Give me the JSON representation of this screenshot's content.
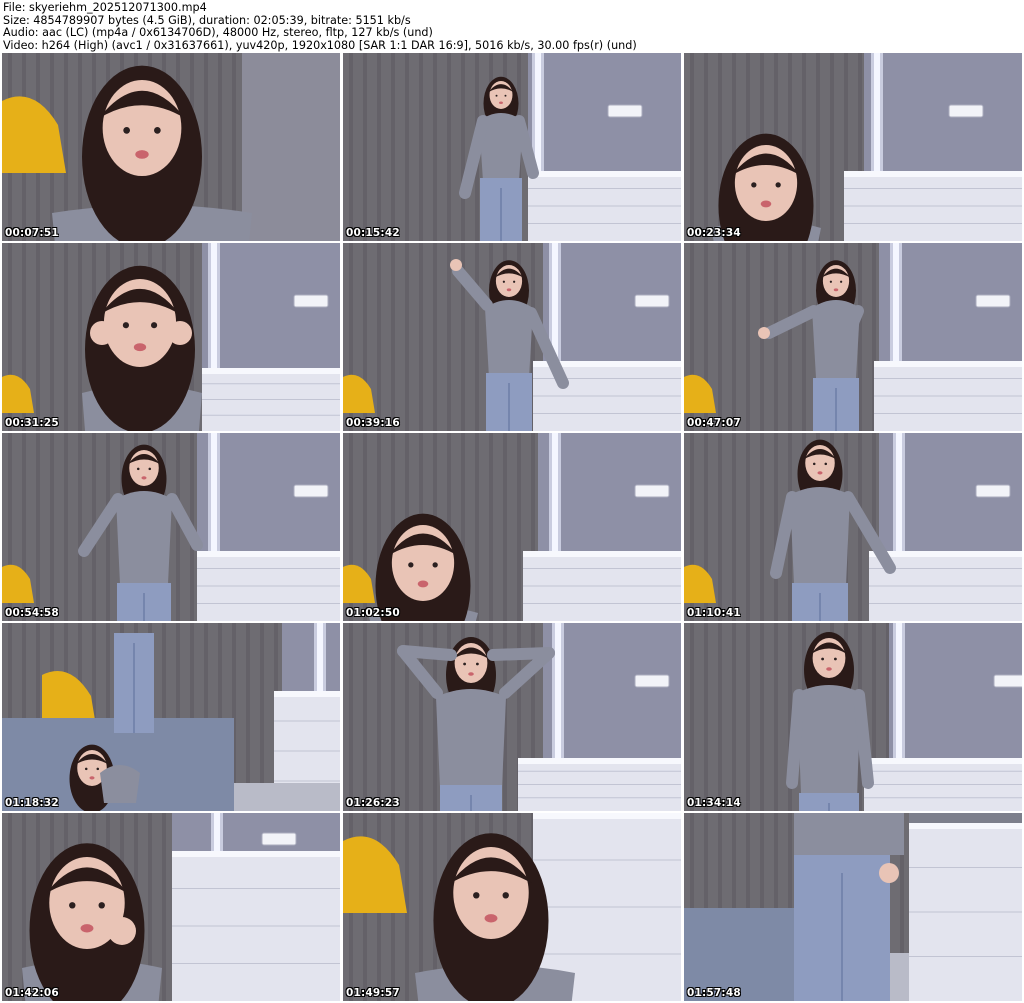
{
  "header": {
    "file_line": "File: skyeriehm_202512071300.mp4",
    "size_line": "Size: 4854789907 bytes (4.5 GiB), duration: 02:05:39, bitrate: 5151 kb/s",
    "audio_line": "Audio: aac (LC) (mp4a / 0x6134706D), 48000 Hz, stereo, fltp, 127 kb/s (und)",
    "video_line": "Video: h264 (High) (avc1 / 0x31637661), yuv420p, 1920x1080 [SAR 1:1 DAR 16:9], 5016 kb/s, 30.00 fps(r) (und)"
  },
  "colors": {
    "curtain": "#6e6c72",
    "wall": "#8e90a6",
    "dresser": "#e3e4ee",
    "shirt": "#8b8e9e",
    "jeans": "#8e9cc0",
    "hair": "#2a1a18",
    "skin": "#e9c4b6",
    "chair": "#e6b018",
    "bed": "#7e8aa6",
    "light": "#f4f6ff"
  },
  "thumbnails": [
    {
      "timestamp": "00:07:51",
      "scene": "face-closeup"
    },
    {
      "timestamp": "00:15:42",
      "scene": "standing-wall"
    },
    {
      "timestamp": "00:23:34",
      "scene": "face-low"
    },
    {
      "timestamp": "00:31:25",
      "scene": "face-hands"
    },
    {
      "timestamp": "00:39:16",
      "scene": "pointing-up"
    },
    {
      "timestamp": "00:47:07",
      "scene": "dancing"
    },
    {
      "timestamp": "00:54:58",
      "scene": "hand-hip"
    },
    {
      "timestamp": "01:02:50",
      "scene": "face-low-tilt"
    },
    {
      "timestamp": "01:10:41",
      "scene": "standing-right"
    },
    {
      "timestamp": "01:18:32",
      "scene": "on-bed-legs-up"
    },
    {
      "timestamp": "01:26:23",
      "scene": "hands-behind-head"
    },
    {
      "timestamp": "01:34:14",
      "scene": "standing-center"
    },
    {
      "timestamp": "01:42:06",
      "scene": "face-hand-chin"
    },
    {
      "timestamp": "01:49:57",
      "scene": "face-center"
    },
    {
      "timestamp": "01:57:48",
      "scene": "jeans-closeup"
    }
  ]
}
